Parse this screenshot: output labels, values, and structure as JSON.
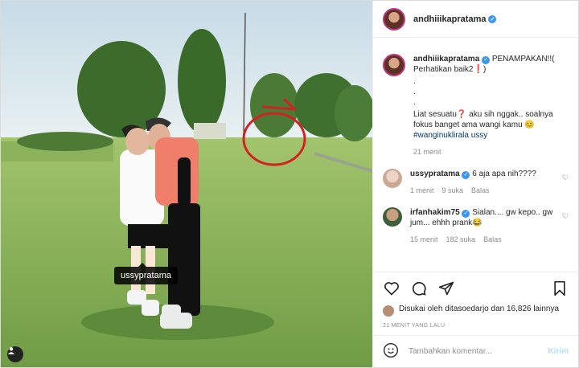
{
  "post": {
    "username": "andhiiikapratama",
    "tag_label": "ussypratama"
  },
  "caption": {
    "username": "andhiiikapratama",
    "line1": "PENAMPAKAN!!( Perhatikan baik2❗)",
    "dots": ".\n.\n.",
    "line2": "Liat sesuatu❓ aku sih nggak.. soalnya fokus banget ama wangi kamu 😊",
    "hashtag": "#wanginuklirala ussy",
    "time": "21 menit"
  },
  "comments": [
    {
      "username": "ussypratama",
      "text": "6 aja apa nih????",
      "time": "1 menit",
      "likes": "9 suka",
      "reply": "Balas"
    },
    {
      "username": "irfanhakim75",
      "text": "Sialan.... gw kepo.. gw jum... ehhh prank😂",
      "time": "15 menit",
      "likes": "182 suka",
      "reply": "Balas"
    }
  ],
  "likes": {
    "text": "Disukai oleh ditasoedarjo dan 16,826 lainnya"
  },
  "posted_ago": "21 MENIT YANG LALU",
  "add_comment": {
    "placeholder": "Tambahkan komentar...",
    "send": "Kirim"
  },
  "colors": {
    "link": "#00376b",
    "verified": "#3897f0",
    "muted": "#8e8e8e"
  },
  "icons": [
    "user-tag-icon",
    "heart-icon",
    "comment-icon",
    "share-icon",
    "bookmark-icon",
    "emoji-icon",
    "verified-icon"
  ]
}
